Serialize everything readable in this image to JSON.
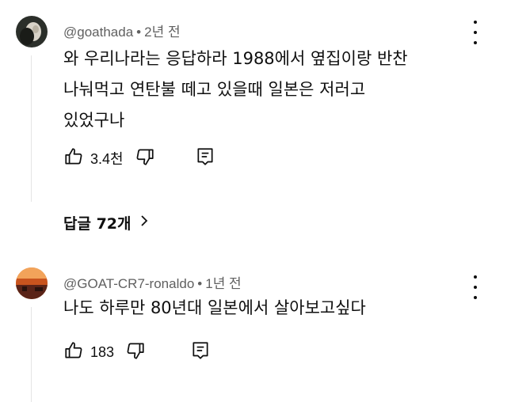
{
  "comments": [
    {
      "author": "@goathada",
      "time": "2년 전",
      "lines": [
        "와 우리나라는 응답하라 1988에서 옆집이랑 반찬",
        "나눠먹고 연탄불 떼고 있을때 일본은 저러고",
        "있었구나"
      ],
      "likes": "3.4천",
      "replies_label": "답글 72개"
    },
    {
      "author": "@GOAT-CR7-ronaldo",
      "time": "1년 전",
      "lines": [
        "나도 하루만 80년대 일본에서 살아보고싶다"
      ],
      "likes": "183"
    }
  ],
  "separator": "•",
  "icons": {
    "like": "thumbs-up-icon",
    "dislike": "thumbs-down-icon",
    "reply": "comment-reply-icon",
    "more": "more-vert-icon",
    "expand": "chevron-right-icon"
  }
}
